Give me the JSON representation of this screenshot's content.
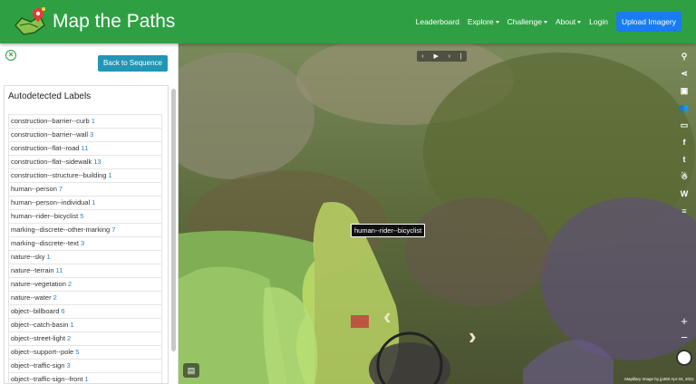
{
  "header": {
    "title": "Map the Paths",
    "nav": [
      {
        "label": "Leaderboard",
        "dropdown": false
      },
      {
        "label": "Explore",
        "dropdown": true
      },
      {
        "label": "Challenge",
        "dropdown": true
      },
      {
        "label": "About",
        "dropdown": true
      },
      {
        "label": "Login",
        "dropdown": false
      }
    ],
    "upload_label": "Upload Imagery"
  },
  "sidebar": {
    "back_label": "Back to Sequence",
    "labels_title": "Autodetected Labels",
    "labels": [
      {
        "name": "construction--barrier--curb",
        "count": "1"
      },
      {
        "name": "construction--barrier--wall",
        "count": "3"
      },
      {
        "name": "construction--flat--road",
        "count": "11"
      },
      {
        "name": "construction--flat--sidewalk",
        "count": "13"
      },
      {
        "name": "construction--structure--building",
        "count": "1"
      },
      {
        "name": "human--person",
        "count": "7"
      },
      {
        "name": "human--person--individual",
        "count": "1"
      },
      {
        "name": "human--rider--bicyclist",
        "count": "5"
      },
      {
        "name": "marking--discrete--other-marking",
        "count": "7"
      },
      {
        "name": "marking--discrete--text",
        "count": "3"
      },
      {
        "name": "nature--sky",
        "count": "1"
      },
      {
        "name": "nature--terrain",
        "count": "11"
      },
      {
        "name": "nature--vegetation",
        "count": "2"
      },
      {
        "name": "nature--water",
        "count": "2"
      },
      {
        "name": "object--billboard",
        "count": "6"
      },
      {
        "name": "object--catch-basin",
        "count": "1"
      },
      {
        "name": "object--street-light",
        "count": "2"
      },
      {
        "name": "object--support--pole",
        "count": "5"
      },
      {
        "name": "object--traffic-sign",
        "count": "3"
      },
      {
        "name": "object--traffic-sign--front",
        "count": "1"
      }
    ]
  },
  "viewer": {
    "tooltip": "human--rider--bicyclist",
    "attribution": "Mapillary  Image by jp360  Apr 03, 2021",
    "toolbar_icons": [
      "binoculars-icon",
      "share-icon",
      "image-frame-icon",
      "users-icon",
      "vr-icon",
      "facebook-icon",
      "twitter-icon",
      "person-icon",
      "wikipedia-icon",
      "layers-icon"
    ],
    "zoom_in": "+",
    "zoom_out": "−"
  }
}
